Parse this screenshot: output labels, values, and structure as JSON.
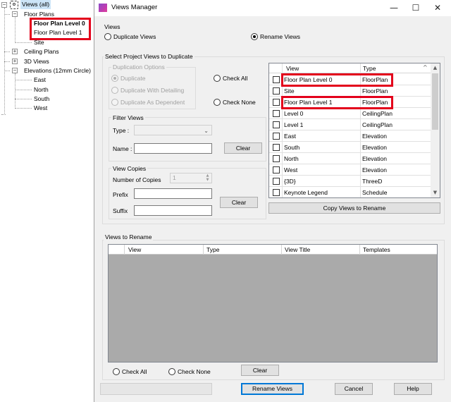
{
  "tree": {
    "root": "Views (all)",
    "floor_plans": "Floor Plans",
    "floor_plan_items": [
      "Floor Plan Level 0",
      "Floor Plan Level 1",
      "Site"
    ],
    "ceiling_plans": "Ceiling Plans",
    "views_3d": "3D Views",
    "elevations": "Elevations (12mm Circle)",
    "elevation_items": [
      "East",
      "North",
      "South",
      "West"
    ]
  },
  "dialog": {
    "title": "Views Manager",
    "window_controls": {
      "minimize": "—",
      "maximize": "☐",
      "close": "✕"
    },
    "views_group": {
      "label": "Views",
      "duplicate": "Duplicate Views",
      "rename": "Rename Views",
      "selected": "rename"
    },
    "select_group": {
      "label": "Select Project Views to Duplicate",
      "duplication_options": {
        "label": "Duplication Options",
        "options": [
          "Duplicate",
          "Duplicate With Detailing",
          "Duplicate As Dependent"
        ]
      },
      "check_all": "Check All",
      "check_none": "Check None",
      "filter": {
        "label": "Filter Views",
        "type_label": "Type :",
        "type_value": "",
        "name_label": "Name :",
        "name_value": "",
        "clear": "Clear"
      },
      "copies": {
        "label": "View Copies",
        "number_label": "Number of Copies",
        "number_value": "1",
        "prefix_label": "Prefix",
        "prefix_value": "",
        "suffix_label": "Suffix",
        "suffix_value": "",
        "clear": "Clear"
      }
    },
    "grid": {
      "columns": [
        "View",
        "Type"
      ],
      "rows": [
        {
          "view": "Floor Plan Level 0",
          "type": "FloorPlan"
        },
        {
          "view": "Site",
          "type": "FloorPlan"
        },
        {
          "view": "Floor Plan Level 1",
          "type": "FloorPlan"
        },
        {
          "view": "Level 0",
          "type": "CeilingPlan"
        },
        {
          "view": "Level 1",
          "type": "CeilingPlan"
        },
        {
          "view": "East",
          "type": "Elevation"
        },
        {
          "view": "South",
          "type": "Elevation"
        },
        {
          "view": "North",
          "type": "Elevation"
        },
        {
          "view": "West",
          "type": "Elevation"
        },
        {
          "view": "{3D}",
          "type": "ThreeD"
        },
        {
          "view": "Keynote Legend",
          "type": "Schedule"
        }
      ]
    },
    "copy_button": "Copy Views to Rename",
    "rename_group": {
      "label": "Views to Rename",
      "columns": [
        "View",
        "Type",
        "View Title",
        "Templates"
      ],
      "check_all": "Check All",
      "check_none": "Check None",
      "clear": "Clear"
    },
    "footer": {
      "rename": "Rename Views",
      "cancel": "Cancel",
      "help": "Help"
    },
    "colors": {
      "highlight": "#e3001b",
      "accent": "#0078d7"
    }
  }
}
